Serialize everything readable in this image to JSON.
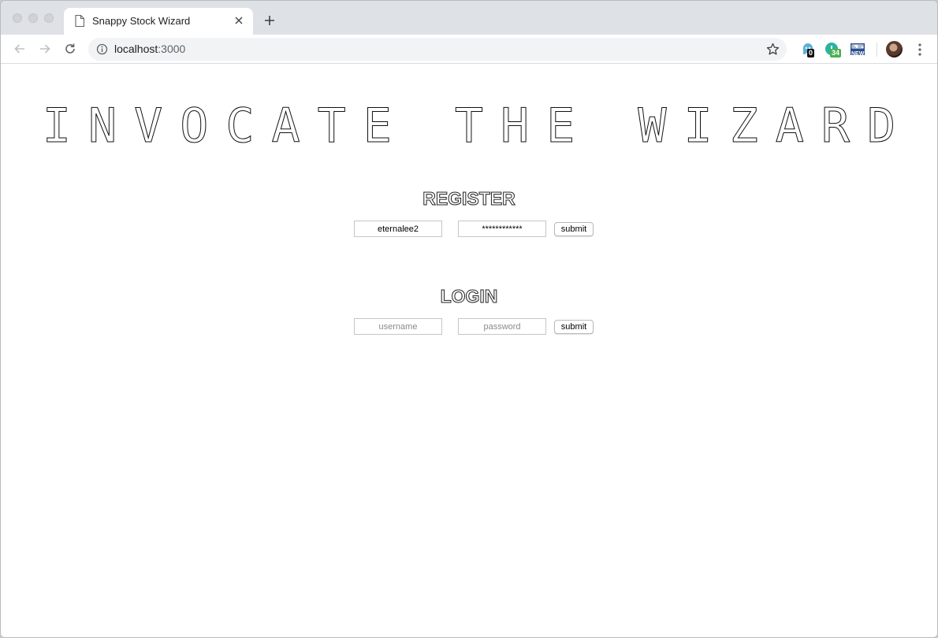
{
  "browser": {
    "tab_title": "Snappy Stock Wizard",
    "url_host": "localhost",
    "url_port": ":3000",
    "extensions": [
      {
        "name": "ghost-extension-icon",
        "badge": "0",
        "badge_color": "#111111",
        "color": "#5ab3d6"
      },
      {
        "name": "grammar-extension-icon",
        "badge": "34",
        "badge_color": "#4caf50",
        "color": "#2bb3a0"
      },
      {
        "name": "news-extension-icon",
        "label": "NEW",
        "color": "#2a4f8f"
      }
    ]
  },
  "page": {
    "hero_title": "INVOCATE THE WIZARD",
    "register": {
      "title": "REGISTER",
      "username_value": "eternalee2",
      "password_value": "************",
      "submit_label": "submit"
    },
    "login": {
      "title": "LOGIN",
      "username_placeholder": "username",
      "password_placeholder": "password",
      "submit_label": "submit"
    }
  }
}
